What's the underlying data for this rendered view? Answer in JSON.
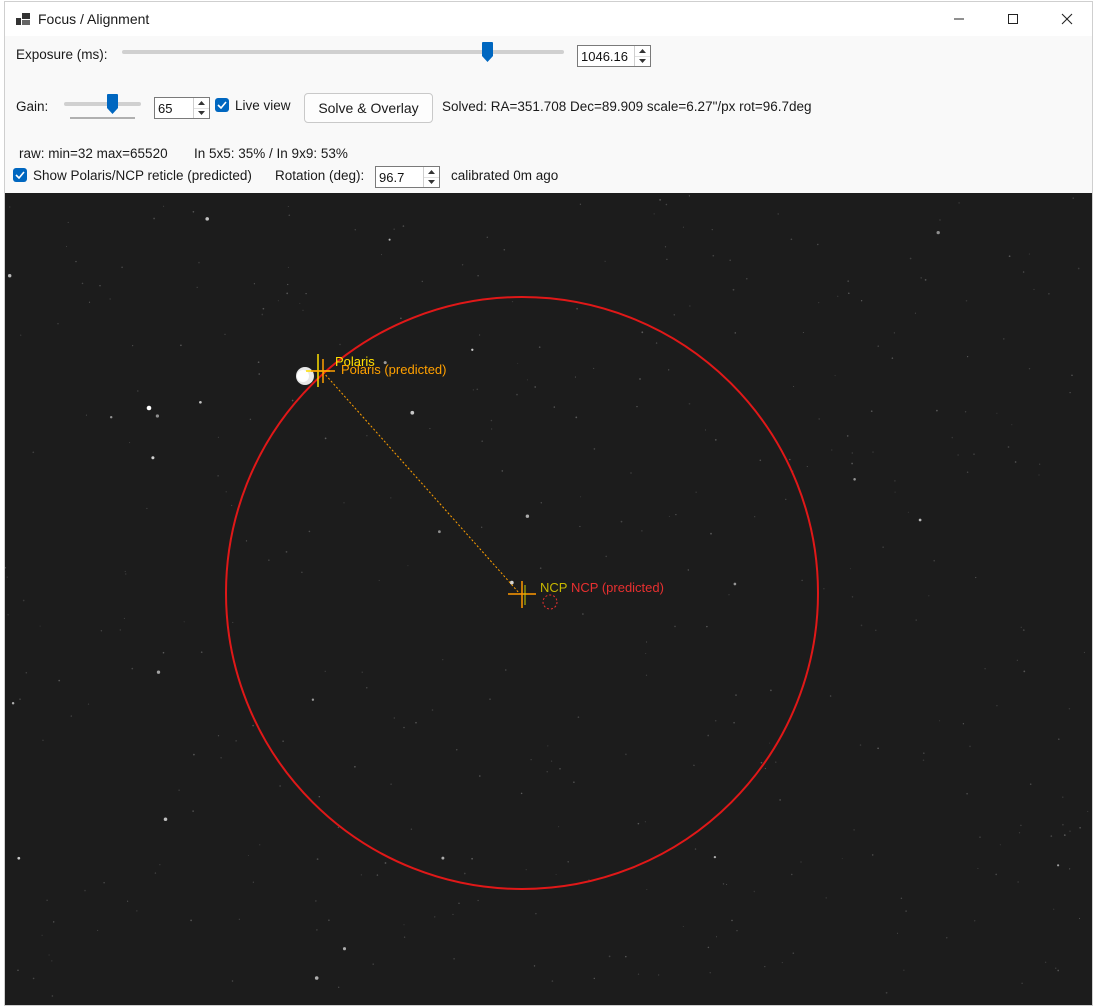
{
  "window": {
    "title": "Focus / Alignment"
  },
  "exposure": {
    "label": "Exposure (ms):",
    "value": "1046.16",
    "slider_fraction": 0.82
  },
  "gain": {
    "label": "Gain:",
    "value": "65",
    "slider_fraction": 0.65
  },
  "live_view": {
    "label": "Live view",
    "checked": true
  },
  "solve_button": {
    "label": "Solve & Overlay"
  },
  "solved_text": "Solved: RA=351.708 Dec=89.909 scale=6.27\"/px rot=96.7deg",
  "stats": {
    "raw": "raw: min=32 max=65520",
    "inner": "In 5x5: 35% / In 9x9: 53%"
  },
  "reticle": {
    "label": "Show Polaris/NCP reticle (predicted)",
    "checked": true
  },
  "rotation": {
    "label": "Rotation (deg):",
    "value": "96.7"
  },
  "calibrated_text": "calibrated 0m ago",
  "overlay": {
    "polaris_label": "Polaris",
    "polaris_predicted_label": "Polaris (predicted)",
    "ncp_label": "NCP",
    "ncp_predicted_label": "NCP (predicted)",
    "colors": {
      "circle": "#e01818",
      "polaris": "#ffe000",
      "polaris_predicted": "#ffa000",
      "ncp": "#ff9800",
      "ncp_predicted": "#e83030",
      "sky": "#1c1c1c"
    }
  }
}
